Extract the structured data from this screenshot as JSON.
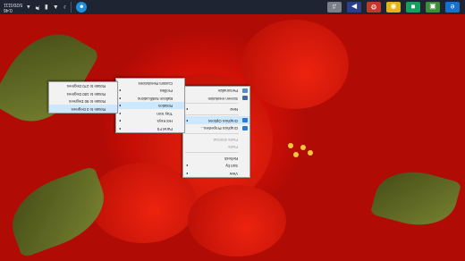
{
  "taskbar": {
    "clock_time": "0:46",
    "clock_date": "5/20/1111",
    "tray_icons": [
      "notification-icon",
      "speaker-icon",
      "network-icon",
      "battery-icon",
      "flag-icon",
      "chevron-up-icon"
    ],
    "pinned_apps": [
      "edge-icon",
      "photos-icon",
      "store-icon",
      "chrome-icon",
      "settings-icon",
      "video-editor-icon",
      "media-icon"
    ]
  },
  "desktop_menu": {
    "items": [
      {
        "label": "View",
        "submenu": true
      },
      {
        "label": "Sort by",
        "submenu": true
      },
      {
        "label": "Refresh"
      },
      {
        "label": "Paste",
        "disabled": true
      },
      {
        "label": "Paste shortcut",
        "disabled": true
      },
      {
        "label": "Graphics Properties...",
        "icon": "intel-graphics-icon"
      },
      {
        "label": "Graphics Options",
        "icon": "intel-graphics-icon",
        "submenu": true,
        "highlighted": true
      },
      {
        "label": "New",
        "submenu": true
      },
      {
        "label": "Screen resolution",
        "icon": "display-icon"
      },
      {
        "label": "Personalize",
        "icon": "personalize-icon"
      }
    ]
  },
  "graphics_options_menu": {
    "items": [
      {
        "label": "Panel Fit",
        "submenu": true
      },
      {
        "label": "Hot Keys",
        "submenu": true
      },
      {
        "label": "Tray Icon",
        "submenu": true
      },
      {
        "label": "Rotation",
        "submenu": true,
        "highlighted": true
      },
      {
        "label": "Balloon Notifications",
        "submenu": true
      },
      {
        "label": "Profiles",
        "submenu": true
      },
      {
        "label": "Custom Resolutions"
      }
    ]
  },
  "rotation_menu": {
    "items": [
      {
        "label": "Rotate to 0 Degrees",
        "highlighted": true
      },
      {
        "label": "Rotate to 90 Degrees"
      },
      {
        "label": "Rotate to 180 Degrees"
      },
      {
        "label": "Rotate to 270 Degrees"
      }
    ]
  }
}
